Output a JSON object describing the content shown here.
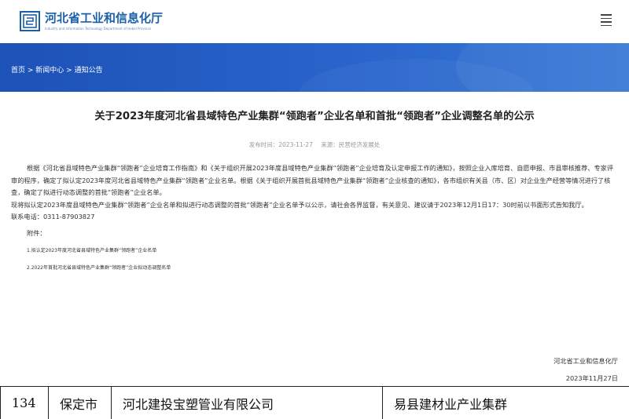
{
  "header": {
    "logo_cn": "河北省工业和信息化厅",
    "logo_en": "Industry and Information Technology Department of Hebei Province"
  },
  "breadcrumb": {
    "home": "首页",
    "sep": " > ",
    "news": "新闻中心",
    "notices": "通知公告"
  },
  "article": {
    "title": "关于2023年度河北省县域特色产业集群“领跑者”企业名单和首批“领跑者”企业调整名单的公示",
    "publish_label": "发布时间：2023-11-27",
    "source_label": "来源：民营经济发展处",
    "para1": "根据《河北省县域特色产业集群“领跑者”企业培育工作指南》和《关于组织开展2023年度县域特色产业集群“领跑者”企业培育及认定申报工作的通知》，按照企业入库培育、自愿申报、市县审核推荐、专家评审的程序，确定了拟认定2023年度河北省县域特色产业集群“领跑者”企业名单。根据《关于组织开展首批县域特色产业集群“领跑者”企业核查的通知》，各市组织有关县（市、区）对企业生产经营等情况进行了核查，确定了拟进行动态调整的首批“领跑者”企业名单。",
    "para2": "现将拟认定2023年度县域特色产业集群“领跑者”企业名单和拟进行动态调整的首批“领跑者”企业名单予以公示，请社会各界监督，有关意见、建议请于2023年12月1日17：30时前以书面形式告知我厅。",
    "contact": "联系电话：0311-87903827",
    "attach_label": "附件：",
    "attach1": "1.拟认定2023年度河北省县域特色产业集群“领跑者”企业名单",
    "attach2": "2.2022年首批河北省县域特色产业集群“领跑者”企业拟动态调整名单",
    "sign_org": "河北省工业和信息化厅",
    "sign_date": "2023年11月27日"
  },
  "table_row": {
    "no": "134",
    "city": "保定市",
    "company": "河北建投宝塑管业有限公司",
    "cluster": "易县建材业产业集群"
  },
  "colors": {
    "brand_blue": "#1a5fa8",
    "banner_blue": "#1d52b8"
  }
}
